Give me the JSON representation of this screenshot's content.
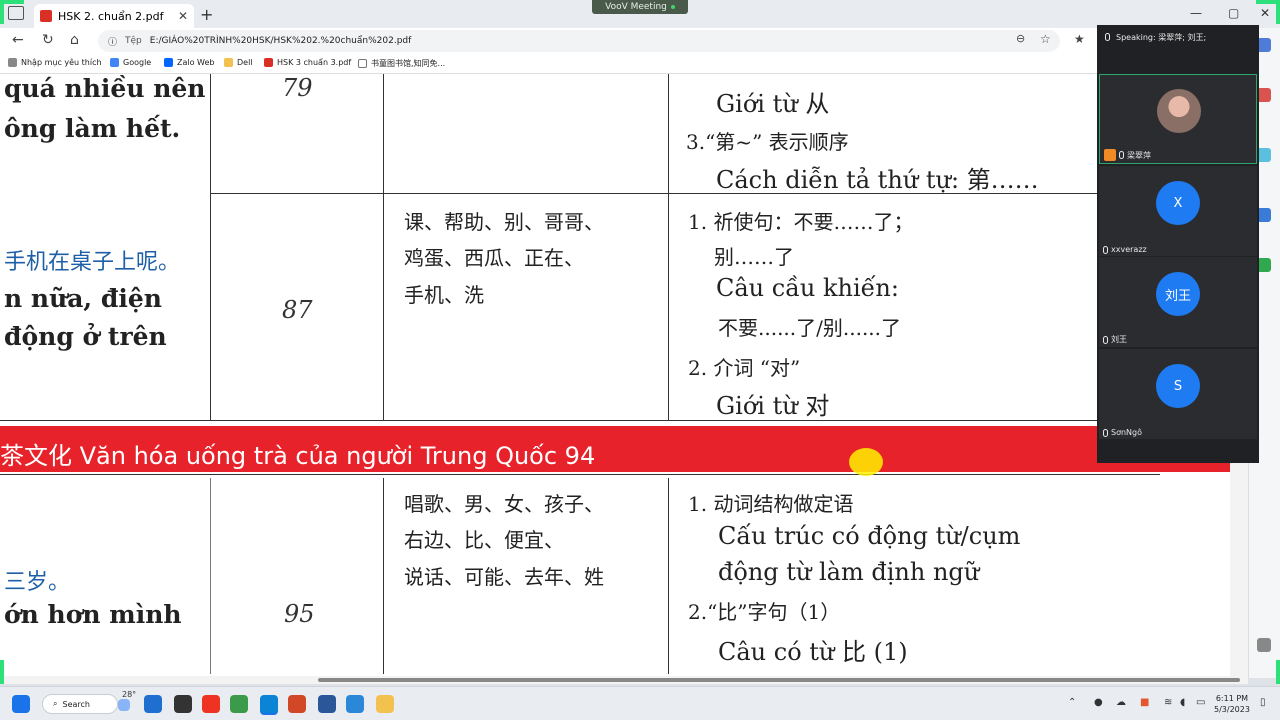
{
  "browser": {
    "tab_title": "HSK 2. chuẩn 2.pdf",
    "tab_close": "✕",
    "new_tab": "+",
    "url_prefix": "Tệp",
    "url": "E:/GIÁO%20TRÌNH%20HSK/HSK%202.%20chuẩn%202.pdf",
    "window_controls": [
      "—",
      "▢",
      "✕"
    ],
    "bookmarks": [
      "Nhập mục yêu thích",
      "Google",
      "Zalo Web",
      "Dell",
      "HSK 3 chuẩn 3.pdf",
      "书童图书馆,知同免..."
    ]
  },
  "meeting_app": {
    "title": "VooV Meeting",
    "speaking": "Speaking: 梁翠萍; 刘王;",
    "participants": [
      {
        "name": "梁翠萍",
        "initial": ""
      },
      {
        "name": "xxverazz",
        "initial": "X"
      },
      {
        "name": "刘王",
        "initial": "刘王"
      },
      {
        "name": "SơnNgô",
        "initial": "S"
      }
    ]
  },
  "document": {
    "row1": {
      "left_lines": [
        "quá nhiều nên",
        "ông làm hết."
      ],
      "page": "79",
      "notes": [
        "Giới từ 从",
        "3.“第~” 表示顺序",
        "Cách diễn tả thứ tự: 第……"
      ]
    },
    "row2": {
      "left_chinese": "手机在桌子上呢。",
      "left_lines": [
        "n nữa, điện",
        "động ở trên"
      ],
      "page": "87",
      "words": [
        "课、帮助、别、哥哥、",
        "鸡蛋、西瓜、正在、",
        "手机、洗"
      ],
      "notes": [
        "1. 祈使句：不要……了；",
        "别……了",
        "Câu cầu khiến:",
        "不要......了/别......了",
        "2. 介词 “对”",
        "Giới từ 对"
      ]
    },
    "section_title": "茶文化 Văn hóa uống trà của người Trung Quốc    94",
    "row3": {
      "left_chinese": "三岁。",
      "left_line": "ớn hơn mình",
      "page": "95",
      "words": [
        "唱歌、男、女、孩子、",
        "右边、比、便宜、",
        "说话、可能、去年、姓"
      ],
      "notes": [
        "1. 动词结构做定语",
        "Cấu trúc có động từ/cụm",
        "động từ làm định ngữ",
        "2.“比”字句（1）",
        "Câu có từ 比 (1)"
      ]
    }
  },
  "taskbar": {
    "search_label": "Search",
    "weather_temp": "28°",
    "time": "6:11 PM",
    "date": "5/3/2023"
  },
  "colors": {
    "section_band": "#e8222a",
    "meeting_bg": "#202124",
    "avatar_blue": "#1e7bf2",
    "frame_green": "#2ee07a"
  }
}
